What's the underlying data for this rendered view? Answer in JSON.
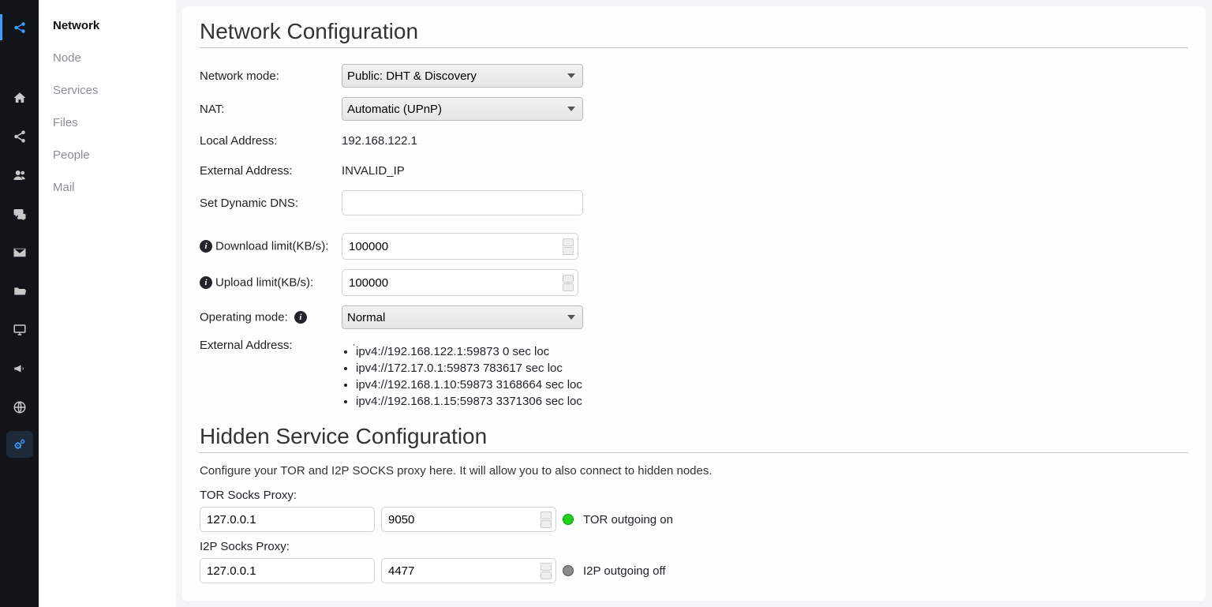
{
  "subnav": {
    "items": [
      {
        "label": "Network",
        "active": true
      },
      {
        "label": "Node"
      },
      {
        "label": "Services"
      },
      {
        "label": "Files"
      },
      {
        "label": "People"
      },
      {
        "label": "Mail"
      }
    ]
  },
  "page": {
    "title": "Network Configuration",
    "rows": {
      "network_mode_label": "Network mode:",
      "network_mode_value": "Public: DHT & Discovery",
      "nat_label": "NAT:",
      "nat_value": "Automatic (UPnP)",
      "local_addr_label": "Local Address:",
      "local_addr_value": "192.168.122.1",
      "ext_addr_label": "External Address:",
      "ext_addr_value": "INVALID_IP",
      "dyn_dns_label": "Set Dynamic DNS:",
      "dyn_dns_value": "",
      "dl_limit_label": "Download limit(KB/s):",
      "dl_limit_value": "100000",
      "ul_limit_label": "Upload limit(KB/s):",
      "ul_limit_value": "100000",
      "op_mode_label": "Operating mode:",
      "op_mode_value": "Normal",
      "ext_addr_list_label": "External Address:",
      "ext_addr_list": [
        "ipv4://192.168.122.1:59873 0 sec loc",
        "ipv4://172.17.0.1:59873 783617 sec loc",
        "ipv4://192.168.1.10:59873 3168664 sec loc",
        "ipv4://192.168.1.15:59873 3371306 sec loc"
      ]
    },
    "hidden": {
      "title": "Hidden Service Configuration",
      "desc": "Configure your TOR and I2P SOCKS proxy here. It will allow you to also connect to hidden nodes.",
      "tor_label": "TOR Socks Proxy:",
      "tor_host": "127.0.0.1",
      "tor_port": "9050",
      "tor_status": "TOR outgoing on",
      "i2p_label": "I2P Socks Proxy:",
      "i2p_host": "127.0.0.1",
      "i2p_port": "4477",
      "i2p_status": "I2P outgoing off"
    }
  }
}
